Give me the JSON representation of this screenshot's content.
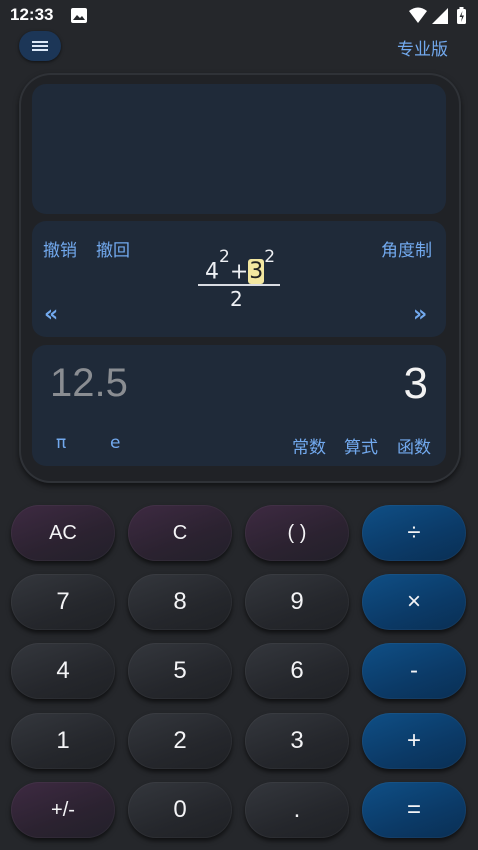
{
  "status_bar": {
    "time": "12:33"
  },
  "top_bar": {
    "pro_label": "专业版"
  },
  "expression_bar": {
    "undo": "撤销",
    "redo": "撤回",
    "angle_mode": "角度制",
    "expression": {
      "base1": "4",
      "exp1": "2",
      "plus": "+",
      "base2": "3",
      "exp2": "2",
      "denominator": "2"
    },
    "nav_left": "«",
    "nav_right": "»"
  },
  "result": {
    "previous": "12.5",
    "current": "3",
    "shortcuts": {
      "pi": "π",
      "e": "e",
      "constants": "常数",
      "formulas": "算式",
      "functions": "函数"
    }
  },
  "keypad": [
    [
      "AC",
      "C",
      "( )",
      "÷"
    ],
    [
      "7",
      "8",
      "9",
      "×"
    ],
    [
      "4",
      "5",
      "6",
      "-"
    ],
    [
      "1",
      "2",
      "3",
      "+"
    ],
    [
      "+/-",
      "0",
      ".",
      "="
    ]
  ],
  "colors": {
    "accent": "#72a9ee",
    "operator_key": "#0b3a67",
    "function_key": "#2b2230",
    "number_key": "#2a2c31",
    "background": "#25272b"
  }
}
